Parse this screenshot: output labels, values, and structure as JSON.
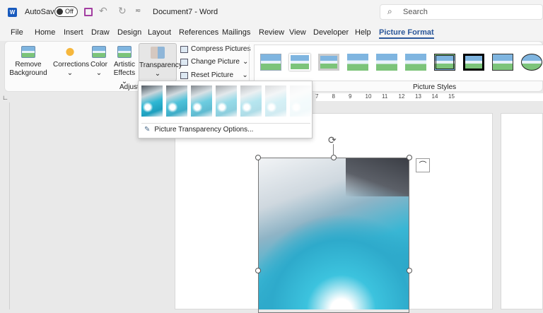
{
  "titlebar": {
    "autosave_label": "AutoSave",
    "autosave_state": "Off",
    "document_title": "Document7 - Word",
    "search_placeholder": "Search"
  },
  "tabs": [
    "File",
    "Home",
    "Insert",
    "Draw",
    "Design",
    "Layout",
    "References",
    "Mailings",
    "Review",
    "View",
    "Developer",
    "Help",
    "Picture Format"
  ],
  "active_tab": "Picture Format",
  "ribbon": {
    "remove_background": [
      "Remove",
      "Background"
    ],
    "corrections": "Corrections",
    "color": "Color",
    "artistic_effects": [
      "Artistic",
      "Effects"
    ],
    "transparency": "Transparency",
    "compress": "Compress Pictures",
    "change": "Change Picture",
    "reset": "Reset Picture",
    "adjust_group": "Adjust",
    "styles_group": "Picture Styles"
  },
  "ruler_numbers": [
    "7",
    "8",
    "9",
    "10",
    "11",
    "12",
    "13",
    "14",
    "15"
  ],
  "transparency_menu": {
    "presets": [
      0,
      15,
      30,
      50,
      65,
      80,
      95
    ],
    "options_label": "Picture Transparency Options..."
  },
  "colors": {
    "accent": "#2b579a",
    "word_blue": "#185abd",
    "save_purple": "#a33ea1"
  }
}
